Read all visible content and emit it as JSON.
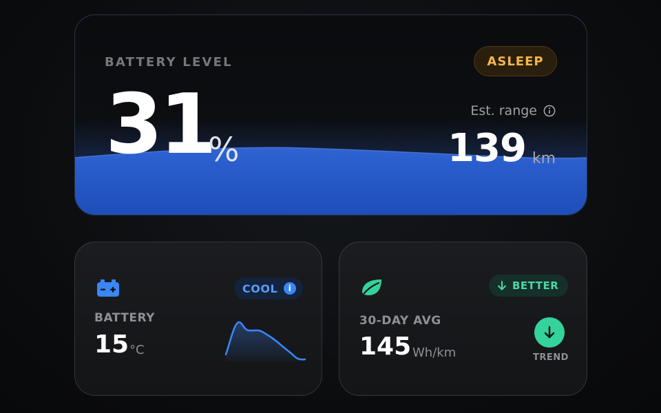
{
  "battery_level": {
    "label": "BATTERY LEVEL",
    "percent": "31",
    "percent_symbol": "%",
    "fill_level": 0.31,
    "status": "ASLEEP",
    "range_label": "Est. range",
    "range_value": "139",
    "range_unit": "km"
  },
  "battery_temp": {
    "label": "BATTERY",
    "value": "15",
    "unit": "°C",
    "badge": "COOL",
    "badge_info": "i"
  },
  "efficiency": {
    "label": "30-DAY AVG",
    "value": "145",
    "unit": "Wh/km",
    "badge": "BETTER",
    "trend_label": "TREND"
  },
  "colors": {
    "accent_blue": "#2f63d3",
    "warning_amber": "#f2b64b",
    "cool_blue": "#3a86f7",
    "good_green": "#34d39c"
  },
  "icons": {
    "battery": "battery-icon",
    "leaf": "leaf-icon",
    "info": "info-icon",
    "arrow_down": "arrow-down-icon"
  }
}
